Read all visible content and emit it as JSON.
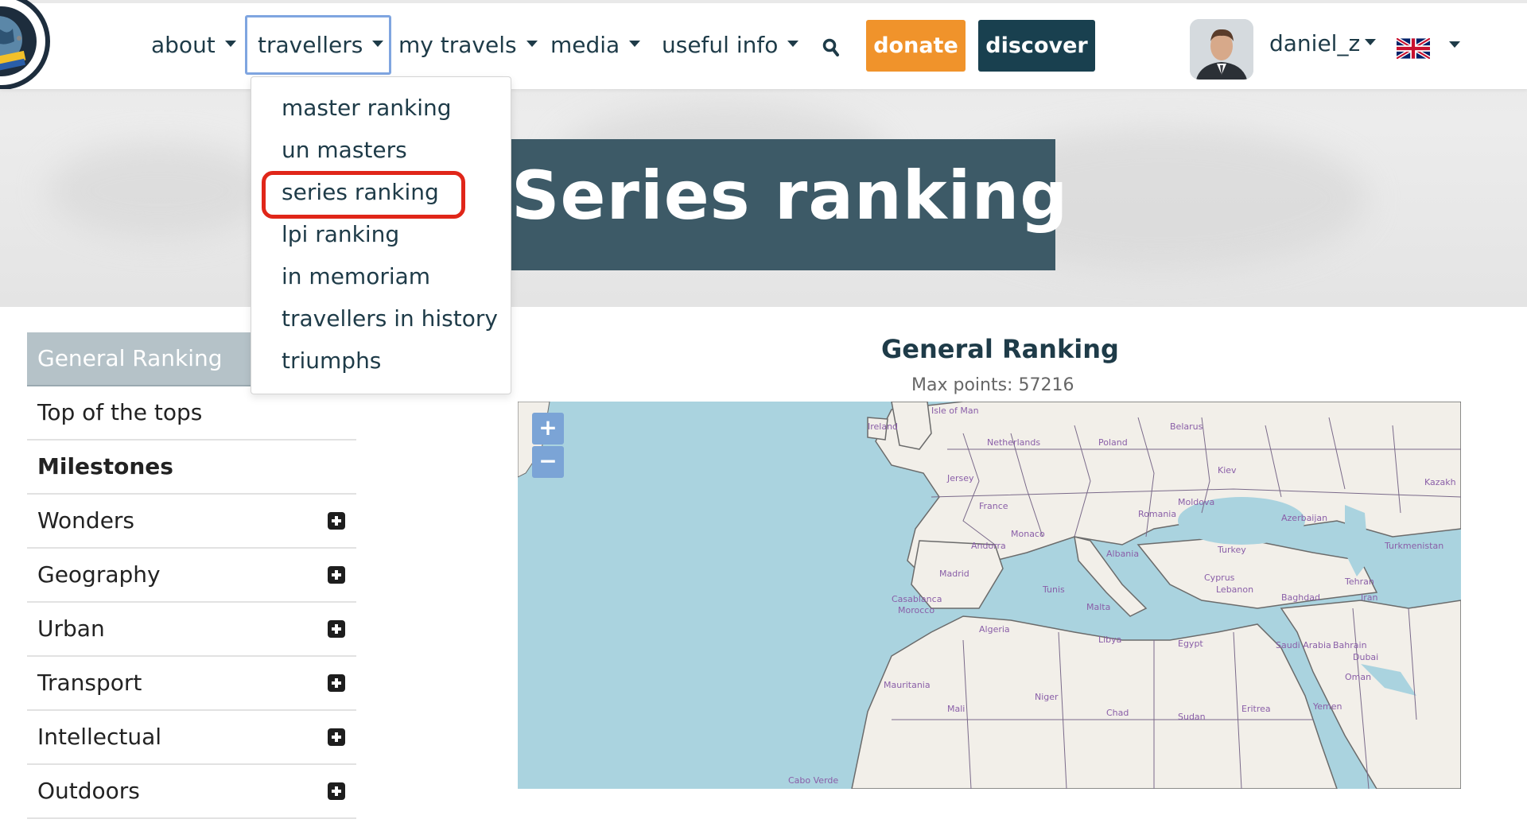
{
  "nav": {
    "items": [
      {
        "label": "about"
      },
      {
        "label": "travellers"
      },
      {
        "label": "my travels"
      },
      {
        "label": "media"
      },
      {
        "label": "useful info"
      }
    ],
    "donate_label": "donate",
    "discover_label": "discover",
    "username": "daniel_z",
    "active_item": "travellers",
    "icons": [
      "search-icon",
      "uk-flag-icon",
      "avatar-photo"
    ],
    "colors": {
      "donate": "#f0932b",
      "discover": "#19404f",
      "text": "#1e3b48"
    }
  },
  "dropdown": {
    "items": [
      {
        "label": "master ranking"
      },
      {
        "label": "un masters"
      },
      {
        "label": "series ranking"
      },
      {
        "label": "lpi ranking"
      },
      {
        "label": "in memoriam"
      },
      {
        "label": "travellers in history"
      },
      {
        "label": "triumphs"
      }
    ],
    "highlighted": "series ranking"
  },
  "hero": {
    "title": "Series ranking"
  },
  "sidebar": {
    "items": [
      {
        "label": "General Ranking",
        "state": "active"
      },
      {
        "label": "Top of the tops"
      },
      {
        "label": "Milestones",
        "state": "bold"
      },
      {
        "label": "Wonders",
        "expandable": true
      },
      {
        "label": "Geography",
        "expandable": true
      },
      {
        "label": "Urban",
        "expandable": true
      },
      {
        "label": "Transport",
        "expandable": true
      },
      {
        "label": "Intellectual",
        "expandable": true
      },
      {
        "label": "Outdoors",
        "expandable": true
      }
    ]
  },
  "main": {
    "title": "General Ranking",
    "subtitle": "Max points: 57216",
    "map": {
      "zoom_in": "+",
      "zoom_out": "−",
      "labels": [
        "Belarus",
        "Poland",
        "Kiev",
        "Moldova",
        "Romania",
        "Netherlands",
        "Jersey",
        "France",
        "Monaco",
        "Andorra",
        "Madrid",
        "Albania",
        "Malta",
        "Tunis",
        "Casablanca",
        "Morocco",
        "Algeria",
        "Libya",
        "Egypt",
        "Mauritania",
        "Mali",
        "Niger",
        "Chad",
        "Sudan",
        "Eritrea",
        "Yemen",
        "Saudi Arabia",
        "Bahrain",
        "Dubai",
        "Oman",
        "Iran",
        "Baghdad",
        "Cyprus",
        "Lebanon",
        "Turkey",
        "Tehran",
        "Turkmenistan",
        "Kazakh",
        "Azerbaijan",
        "Isle of Man",
        "Ireland",
        "Cabo Verde"
      ]
    }
  }
}
